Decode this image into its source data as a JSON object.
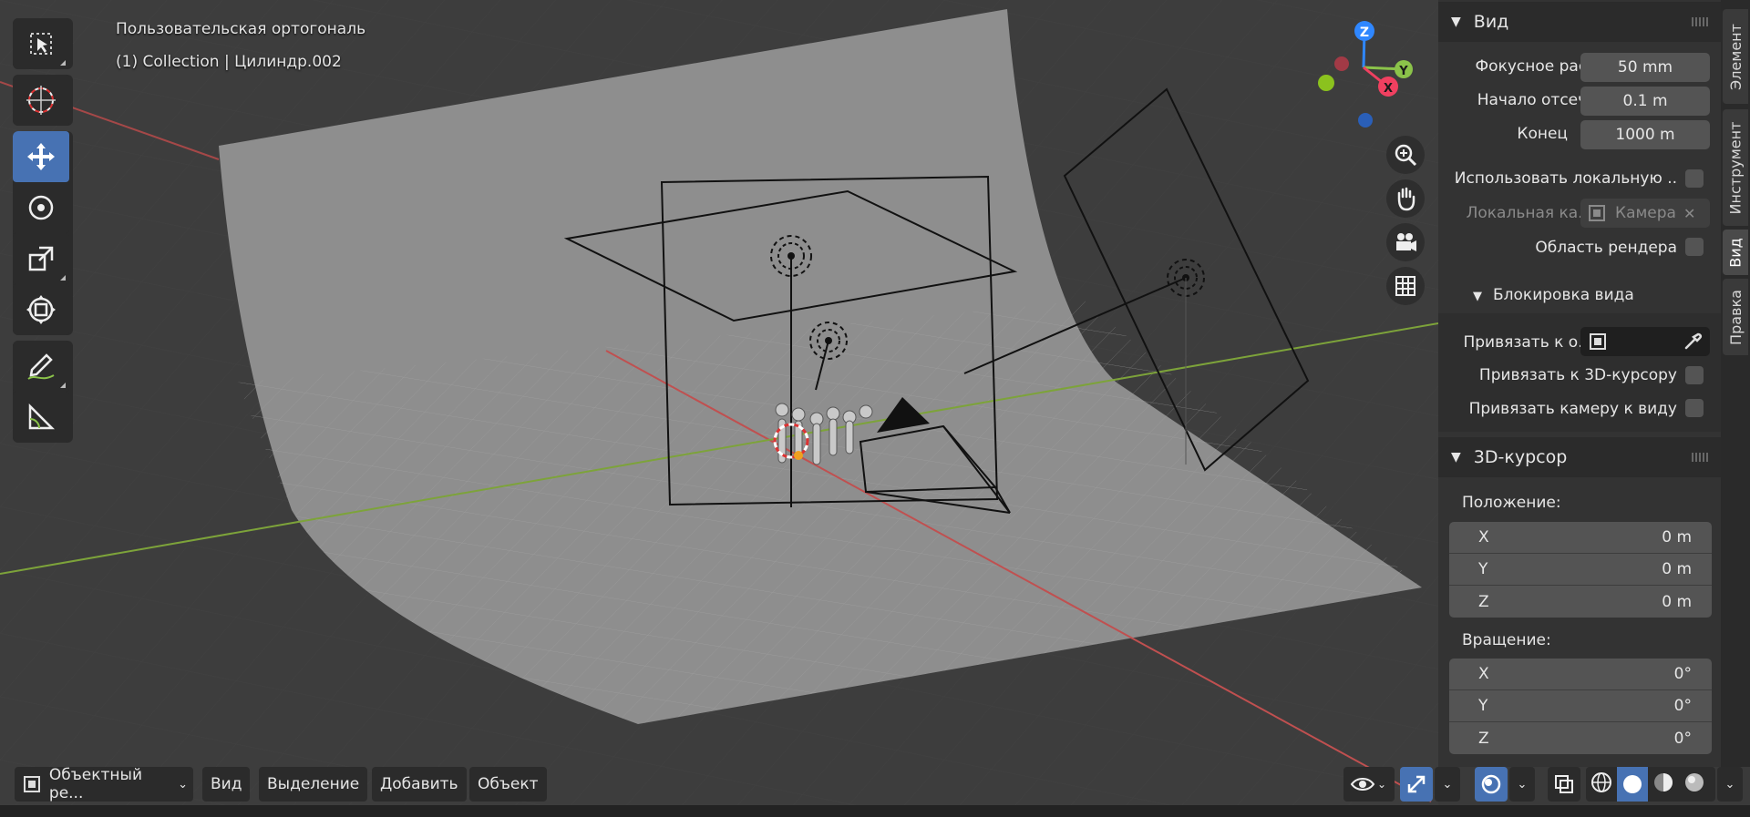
{
  "viewport": {
    "view_name": "Пользовательская ортогональ",
    "collection_info": "(1) Collection | Цилиндр.002",
    "gizmo": {
      "z": "Z",
      "y": "Y",
      "x": "X"
    }
  },
  "toolbar": {
    "tools": [
      "select-box-icon",
      "cursor-icon",
      "move-icon",
      "rotate-icon",
      "scale-icon",
      "transform-icon",
      "annotate-icon",
      "measure-icon"
    ],
    "active": "move-icon"
  },
  "header": {
    "mode": "Объектный ре...",
    "menus": [
      "Вид",
      "Выделение",
      "Добавить",
      "Объект"
    ]
  },
  "npanel": {
    "view_section": {
      "title": "Вид",
      "focal_label": "Фокусное рас..",
      "focal_value": "50 mm",
      "clip_start_label": "Начало отсеч..",
      "clip_start_value": "0.1 m",
      "clip_end_label": "Конец",
      "clip_end_value": "1000 m",
      "use_local_label": "Использовать локальную ..",
      "local_camera_label": "Локальная ка..",
      "local_camera_value": "Камера",
      "render_region_label": "Область рендера"
    },
    "view_lock": {
      "title": "Блокировка вида",
      "lock_to_object_label": "Привязать к о..",
      "lock_to_cursor_label": "Привязать к 3D-курсору",
      "lock_camera_label": "Привязать камеру к виду"
    },
    "cursor_section": {
      "title": "3D-курсор",
      "location_label": "Положение:",
      "location": [
        {
          "axis": "X",
          "value": "0 m"
        },
        {
          "axis": "Y",
          "value": "0 m"
        },
        {
          "axis": "Z",
          "value": "0 m"
        }
      ],
      "rotation_label": "Вращение:",
      "rotation": [
        {
          "axis": "X",
          "value": "0°"
        },
        {
          "axis": "Y",
          "value": "0°"
        },
        {
          "axis": "Z",
          "value": "0°"
        }
      ]
    }
  },
  "tabs": [
    "Элемент",
    "Инструмент",
    "Вид",
    "Правка"
  ],
  "active_tab": "Вид",
  "colors": {
    "accent": "#4772b3",
    "gizmo_z": "#2f87ff",
    "gizmo_y": "#8bc34a",
    "gizmo_x": "#f04060"
  }
}
